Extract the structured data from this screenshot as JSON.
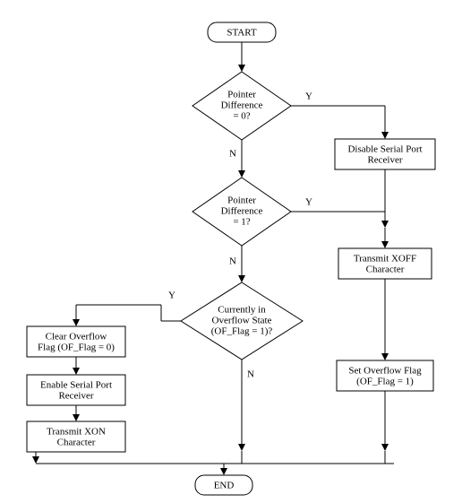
{
  "start": "START",
  "end": "END",
  "dec1_l1": "Pointer",
  "dec1_l2": "Difference",
  "dec1_l3": "= 0?",
  "dec2_l1": "Pointer",
  "dec2_l2": "Difference",
  "dec2_l3": "= 1?",
  "dec3_l1": "Currently in",
  "dec3_l2": "Overflow State",
  "dec3_l3": "(OF_Flag = 1)?",
  "p_disable_l1": "Disable Serial Port",
  "p_disable_l2": "Receiver",
  "p_txoff_l1": "Transmit XOFF",
  "p_txoff_l2": "Character",
  "p_setof_l1": "Set Overflow Flag",
  "p_setof_l2": "(OF_Flag = 1)",
  "p_clrof_l1": "Clear Overflow",
  "p_clrof_l2": "Flag (OF_Flag = 0)",
  "p_enable_l1": "Enable Serial Port",
  "p_enable_l2": "Receiver",
  "p_txon_l1": "Transmit XON",
  "p_txon_l2": "Character",
  "Y": "Y",
  "N": "N"
}
